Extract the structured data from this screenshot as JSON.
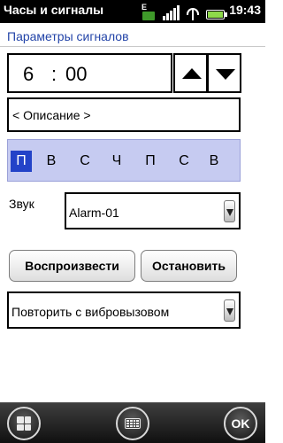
{
  "status_bar": {
    "app_title": "Часы и сигналы",
    "network_letter": "E",
    "time": "19:43",
    "icons": [
      "network-e-icon",
      "signal-strength-icon",
      "wifi-icon",
      "battery-icon"
    ]
  },
  "header": {
    "title": "Параметры сигналов",
    "title_color": "#2344a8"
  },
  "time_picker": {
    "hours": "6",
    "separator": ":",
    "minutes": "00",
    "up_icon": "up-arrow-icon",
    "down_icon": "down-arrow-icon"
  },
  "description": {
    "value": "< Описание >"
  },
  "days": {
    "labels": [
      "П",
      "В",
      "С",
      "Ч",
      "П",
      "С",
      "В"
    ],
    "selected_index": 0,
    "selected_color": "#2343c8",
    "background_color": "#c6cbf1"
  },
  "sound": {
    "label": "Звук",
    "selected": "Alarm-01"
  },
  "buttons": {
    "play": "Воспроизвести",
    "stop": "Остановить"
  },
  "vibration": {
    "selected": "Повторить с вибровызовом"
  },
  "bottom_bar": {
    "start_icon": "windows-start-icon",
    "keyboard_icon": "keyboard-icon",
    "ok_label": "OK"
  }
}
